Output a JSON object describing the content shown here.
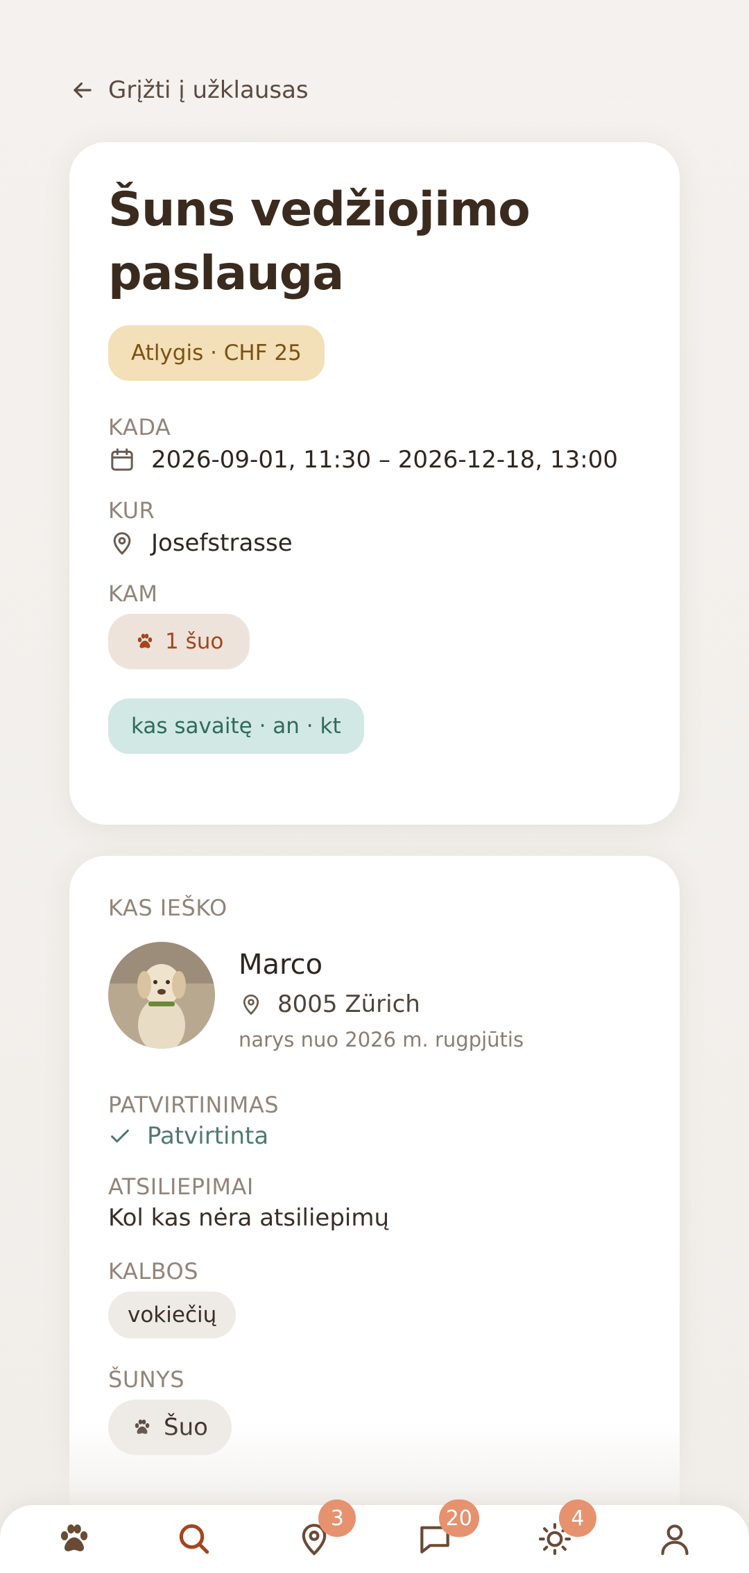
{
  "back": {
    "label": "Grįžti į užklausas",
    "icon": "arrow-left-icon"
  },
  "request": {
    "title": "Šuns vedžiojimo paslauga",
    "pay": "Atlygis · CHF 25",
    "when_label": "KADA",
    "when_value": "2026-09-01, 11:30 – 2026-12-18, 13:00",
    "where_label": "KUR",
    "where_value": "Josefstrasse",
    "for_label": "KAM",
    "for_value": "1 šuo",
    "frequency": "kas savaitę · an · kt"
  },
  "seeker": {
    "section_label": "KAS IEŠKO",
    "name": "Marco",
    "location": "8005 Zürich",
    "member_since": "narys nuo 2026 m. rugpjūtis",
    "verification_label": "PATVIRTINIMAS",
    "verification_value": "Patvirtinta",
    "reviews_label": "ATSILIEPIMAI",
    "reviews_value": "Kol kas nėra atsiliepimų",
    "languages_label": "KALBOS",
    "languages": [
      "vokiečių"
    ],
    "dogs_label": "ŠUNYS",
    "dogs": [
      "Šuo"
    ]
  },
  "nav": {
    "items": [
      {
        "name": "paw",
        "icon": "paw-icon",
        "badge": ""
      },
      {
        "name": "search",
        "icon": "search-icon",
        "badge": ""
      },
      {
        "name": "map",
        "icon": "map-pin-icon",
        "badge": "3"
      },
      {
        "name": "messages",
        "icon": "chat-icon",
        "badge": "20"
      },
      {
        "name": "activity",
        "icon": "sun-icon",
        "badge": "4"
      },
      {
        "name": "profile",
        "icon": "user-icon",
        "badge": ""
      }
    ]
  },
  "colors": {
    "accent": "#a5451d",
    "badge": "#e6926e",
    "pay_chip_bg": "#f3dfb8",
    "freq_chip_bg": "#d2e8e5"
  }
}
